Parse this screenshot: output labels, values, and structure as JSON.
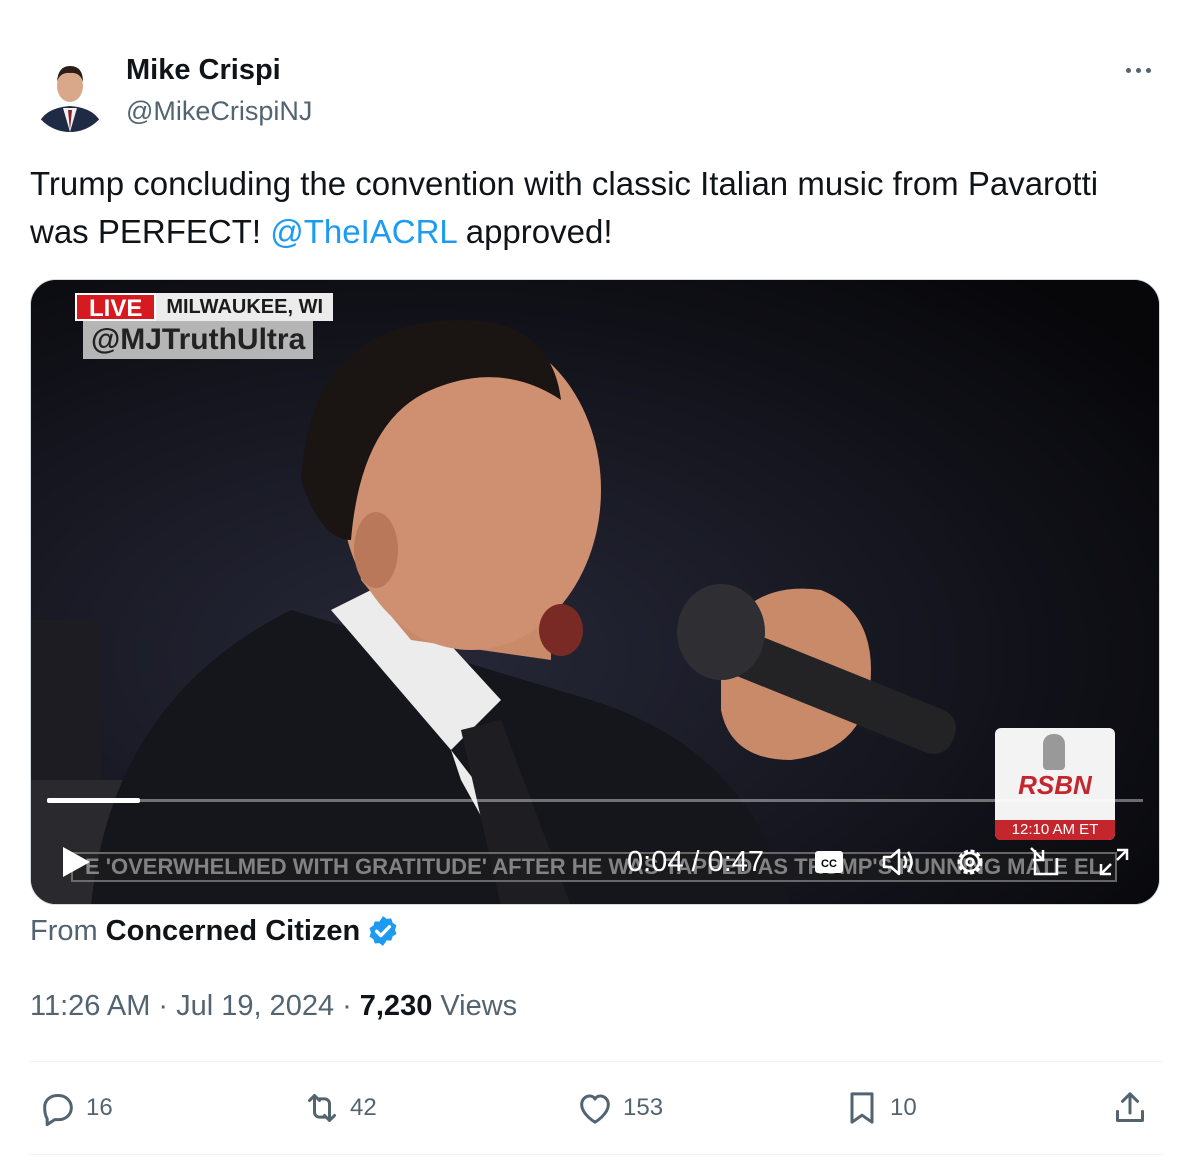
{
  "author": {
    "name": "Mike Crispi",
    "handle": "@MikeCrispiNJ"
  },
  "tweet": {
    "text_before": "Trump concluding the convention with classic Italian music from Pavarotti was PERFECT! ",
    "mention": "@TheIACRL",
    "text_after": " approved!"
  },
  "video": {
    "live_label": "LIVE",
    "location": "MILWAUKEE, WI",
    "watermark": "@MJTruthUltra",
    "network_logo": "RSBN",
    "network_time": "12:10 AM ET",
    "ticker": "E 'OVERWHELMED WITH GRATITUDE' AFTER HE WAS TAPPED AS TRUMP'S RUNNING MATE  EL",
    "current_time": "0:04",
    "duration": "0:47",
    "time_display": "0:04 / 0:47",
    "progress_fraction": 0.085,
    "cc_label": "CC"
  },
  "source": {
    "prefix": "From",
    "name": "Concerned Citizen"
  },
  "meta": {
    "time": "11:26 AM",
    "date": "Jul 19, 2024",
    "views_count": "7,230",
    "views_label": "Views"
  },
  "actions": {
    "replies": "16",
    "reposts": "42",
    "likes": "153",
    "bookmarks": "10"
  },
  "colors": {
    "accent": "#1d9bf0",
    "text": "#0f1419",
    "muted": "#536471"
  }
}
